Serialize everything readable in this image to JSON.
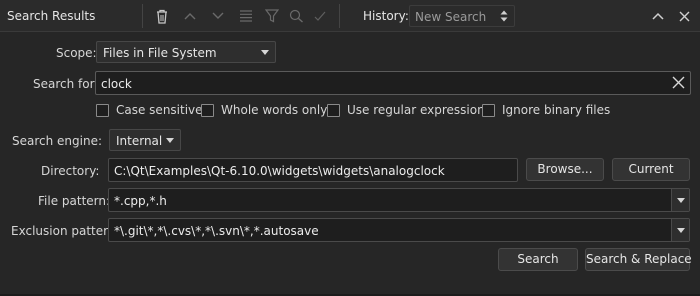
{
  "toolbar": {
    "title": "Search Results",
    "history_label": "History:",
    "history_value": "New Search",
    "icons": [
      "trash-icon",
      "collapse-up-icon",
      "expand-down-icon",
      "list-icon",
      "filter-icon",
      "replace-icon",
      "check-icon",
      "chevron-up-icon",
      "close-icon"
    ]
  },
  "scope": {
    "label": "Scope:",
    "value": "Files in File System"
  },
  "search_for": {
    "label": "Search for:",
    "value": "clock"
  },
  "options": {
    "case_sensitive": "Case sensitive",
    "whole_words": "Whole words only",
    "regex": "Use regular expressions",
    "ignore_binary": "Ignore binary files"
  },
  "engine": {
    "label": "Search engine:",
    "value": "Internal"
  },
  "directory": {
    "label": "Directory:",
    "value": "C:\\Qt\\Examples\\Qt-6.10.0\\widgets\\widgets\\analogclock",
    "browse": "Browse...",
    "current": "Current"
  },
  "file_pattern": {
    "label": "File pattern:",
    "value": "*.cpp,*.h"
  },
  "exclusion_pattern": {
    "label": "Exclusion pattern:",
    "value": "*\\.git\\*,*\\.cvs\\*,*\\.svn\\*,*.autosave"
  },
  "actions": {
    "search": "Search",
    "search_replace": "Search & Replace"
  },
  "colors": {
    "background": "#262626",
    "field": "#1e1e1e",
    "text": "#d6d6d6"
  }
}
